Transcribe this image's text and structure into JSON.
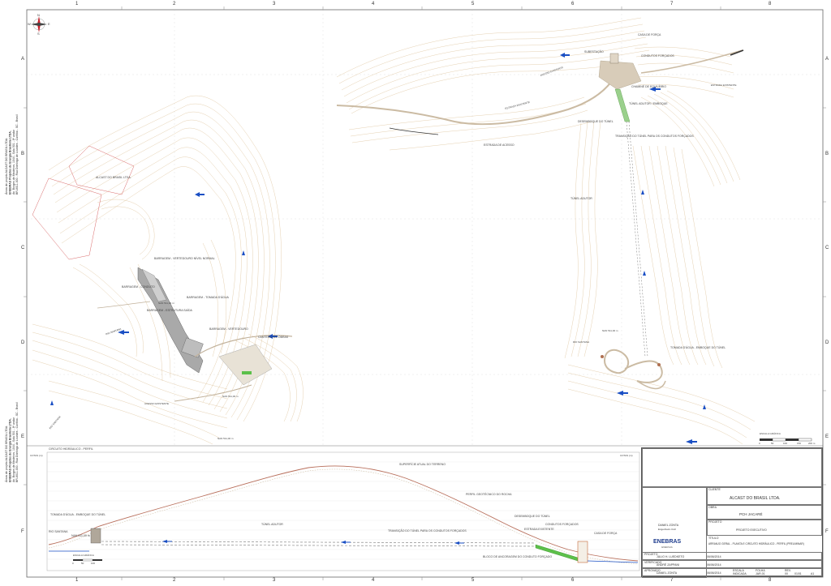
{
  "grid": {
    "columns": [
      "1",
      "2",
      "3",
      "4",
      "5",
      "6",
      "7",
      "8"
    ],
    "rows": [
      "A",
      "B",
      "C",
      "D",
      "E",
      "F"
    ]
  },
  "compass": {
    "north": "N",
    "south": "S",
    "east": "E",
    "west": "W"
  },
  "side_labels": {
    "company_block_1": [
      "Áreas de projeto ALCAST DO BRASIL LTDA.",
      "ENEBRAS Projetos de Energia Brasileira LTDA.",
      "Av. Borges de Medeiros, 1044 - Sala 501 - 8º andar",
      "BR-8011-000 - Rua Dominga de Lourdes - Curitiba - SC - Brasil"
    ],
    "company_block_2": [
      "Áreas de projeto ALCAST DO BRASIL LTDA.",
      "ENEBRAS Projetos de Energia Brasileira LTDA.",
      "Av. Borges de Medeiros, 1044 - Sala 501 - 8º andar",
      "BR-8011-000 - Rua Dominga de Lourdes - Curitiba - SC - Brasil"
    ]
  },
  "plan_left": {
    "labels": [
      {
        "text": "BARRAGEM - VERTEDOURO NÍVEL NORMAL",
        "style": "small"
      },
      {
        "text": "BARRAGEM - TOMADA D'ÁGUA",
        "style": "small"
      },
      {
        "text": "BARRAGEM - CONDUTO",
        "style": "small"
      },
      {
        "text": "BARRAGEM - VERTEDOURO",
        "style": "small"
      },
      {
        "text": "BARRAGEM - ESTRUTURA SAÍDA",
        "style": "small"
      },
      {
        "text": "CANTEIRO DE OBRAS",
        "style": "small"
      },
      {
        "text": "ALCAST DO BRASIL LTDA.",
        "style": "small"
      },
      {
        "text": "RIO SANTANA",
        "style": "tiny"
      },
      {
        "text": "RIO SANTANA",
        "style": "tiny"
      },
      {
        "text": "ACESSO EXISTENTE",
        "style": "tiny"
      },
      {
        "text": "NAN 511,00 m",
        "style": "tiny"
      },
      {
        "text": "NAN 511,00 m",
        "style": "tiny"
      },
      {
        "text": "NAN 511,00 m",
        "style": "tiny"
      }
    ]
  },
  "plan_right": {
    "labels": [
      {
        "text": "CASA DE FORÇA",
        "style": "small"
      },
      {
        "text": "SUBESTAÇÃO",
        "style": "small"
      },
      {
        "text": "CONDUTOS FORÇADOS",
        "style": "small"
      },
      {
        "text": "ACESSO EXISTENTE",
        "style": "tiny"
      },
      {
        "text": "CHAMINÉ DE EQUILÍBRIO",
        "style": "small"
      },
      {
        "text": "TÚNEL ADUTOR / EMBOQUE",
        "style": "small"
      },
      {
        "text": "DESEMBOQUE DO TÚNEL",
        "style": "small"
      },
      {
        "text": "TRANSIÇÃO DO TÚNEL PARA OS CONDUTOS FORÇADOS",
        "style": "small"
      },
      {
        "text": "ESTRADA EXISTENTE",
        "style": "tiny"
      },
      {
        "text": "ESTRADA EXISTENTE",
        "style": "tiny"
      },
      {
        "text": "TÚNEL ADUTOR",
        "style": "small"
      },
      {
        "text": "ESTRADA DE ACESSO",
        "style": "small"
      },
      {
        "text": "TOMADA D'ÁGUA - EMBOQUE DO TÚNEL",
        "style": "small"
      },
      {
        "text": "RIO SANTANA",
        "style": "tiny"
      },
      {
        "text": "NAN 511,00 m",
        "style": "tiny"
      }
    ]
  },
  "scale_bar": {
    "label": "ESCALA GRÁFICA",
    "ticks": [
      "0",
      "50",
      "100",
      "150",
      "200 m"
    ]
  },
  "profile": {
    "title": "CIRCUITO HIDRÁULICO - PERFIL",
    "labels": [
      {
        "text": "SUPERFÍCIE ATUAL DO TERRENO"
      },
      {
        "text": "PERFIL GEOTÉCNICO DO ROCHA"
      },
      {
        "text": "DESEMBOQUE DO TÚNEL"
      },
      {
        "text": "TOMADA D'ÁGUA - EMBOQUE DO TÚNEL"
      },
      {
        "text": "TÚNEL ADUTOR"
      },
      {
        "text": "TRANSIÇÃO DO TÚNEL PARA OS CONDUTOS FORÇADOS"
      },
      {
        "text": "CONDUTOS FORÇADOS"
      },
      {
        "text": "CASA DE FORÇA"
      },
      {
        "text": "RIO SANTANA"
      },
      {
        "text": "BLOCO DE ANCORAGEM DO CONDUTO FORÇADO"
      },
      {
        "text": "ESTRADA EXISTENTE"
      },
      {
        "text": "NAN 511,00 m"
      },
      {
        "text": "COTAS (m)"
      }
    ],
    "scale": {
      "label": "ESCALA GRÁFICA",
      "ticks": [
        "0",
        "50",
        "100"
      ]
    }
  },
  "title_block": {
    "headers": [
      "CLIENTE",
      "OBRA",
      "TÍTULO",
      "PROJETO",
      "VERIFICADO",
      "APROVADO",
      "ESCALA",
      "FOLHA",
      "REV."
    ],
    "client": "ALCAST DO BRASIL LTDA.",
    "work": "PCH JACARÉ",
    "title": "ARRANJO GERAL - PLANTA E CIRCUITO HIDRÁULICO - PERFIL (PRELIMINAR)",
    "phase": "PROJETO EXECUTIVO",
    "engineer": "DANIEL ZONTA",
    "engineer_role": "Engenheiro Civil",
    "logo": "ENEBRAS",
    "logo_sub": "ENERGIA",
    "rows": [
      {
        "name": "JULIO H. LUEDKETO",
        "date": "06/06/2014"
      },
      {
        "name": "ANDRÉ ZAPPANI",
        "date": "06/06/2014"
      },
      {
        "name": "DANIEL ZONTA",
        "date": "06/06/2014"
      }
    ],
    "scale": "INDICADA",
    "sheet": "JAR-01",
    "sheet_count": "01/01",
    "size": "A1",
    "revision": "00"
  }
}
